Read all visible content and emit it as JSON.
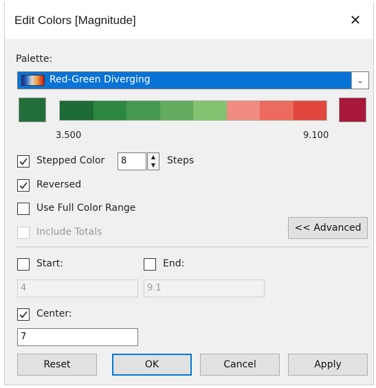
{
  "window": {
    "title": "Edit Colors [Magnitude]"
  },
  "palette": {
    "label": "Palette:",
    "selected": "Red-Green Diverging",
    "start_color": "#236e3a",
    "end_color": "#a8183a",
    "steps": [
      "#1f6b35",
      "#2e8741",
      "#46974f",
      "#62ab5f",
      "#83c36f",
      "#f08b80",
      "#ec6a5e",
      "#e2473d"
    ],
    "min_label": "3.500",
    "max_label": "9.100"
  },
  "options": {
    "stepped_color": {
      "label": "Stepped Color",
      "checked": true,
      "value": "8",
      "suffix": "Steps"
    },
    "reversed": {
      "label": "Reversed",
      "checked": true
    },
    "use_full_color_range": {
      "label": "Use Full Color Range",
      "checked": false
    },
    "include_totals": {
      "label": "Include Totals",
      "checked": false,
      "disabled": true
    }
  },
  "advanced_button": "<< Advanced",
  "range": {
    "start": {
      "label": "Start:",
      "checked": false,
      "value": "4"
    },
    "end": {
      "label": "End:",
      "checked": false,
      "value": "9.1"
    },
    "center": {
      "label": "Center:",
      "checked": true,
      "value": "7"
    }
  },
  "buttons": {
    "reset": "Reset",
    "ok": "OK",
    "cancel": "Cancel",
    "apply": "Apply"
  },
  "colors": {
    "accent": "#0078d7",
    "selection": "#0a73d6",
    "dialog_bg": "#f0f0f0"
  }
}
